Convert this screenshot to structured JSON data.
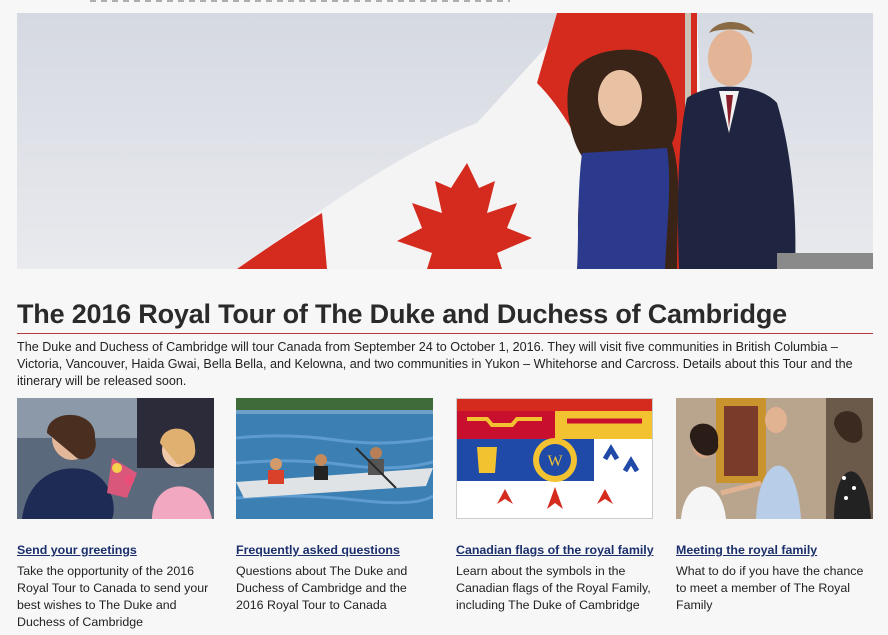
{
  "page": {
    "title": "The 2016 Royal Tour of The Duke and Duchess of Cambridge",
    "intro": "The Duke and Duchess of Cambridge will tour Canada from September 24 to October 1, 2016. They will visit five communities in British Columbia – Victoria, Vancouver, Haida Gwai, Bella Bella, and Kelowna, and two communities in Yukon – Whitehorse and Carcross. Details about this Tour and the itinerary will be released soon."
  },
  "cards": [
    {
      "link": "Send your greetings",
      "desc": "Take the opportunity of the 2016 Royal Tour to Canada to send your best wishes to The Duke and Duchess of Cambridge"
    },
    {
      "link": "Frequently asked questions",
      "desc": "Questions about The Duke and Duchess of Cambridge and the 2016 Royal Tour to Canada"
    },
    {
      "link": "Canadian flags of the royal family",
      "desc": "Learn about the symbols in the Canadian flags of the Royal Family, including The Duke of Cambridge"
    },
    {
      "link": "Meeting the royal family",
      "desc": "What to do if you have the chance to meet a member of The Royal Family"
    }
  ],
  "colors": {
    "link": "#1b2f6b",
    "rule": "#b73a3a",
    "flag_red": "#d52b1e"
  }
}
